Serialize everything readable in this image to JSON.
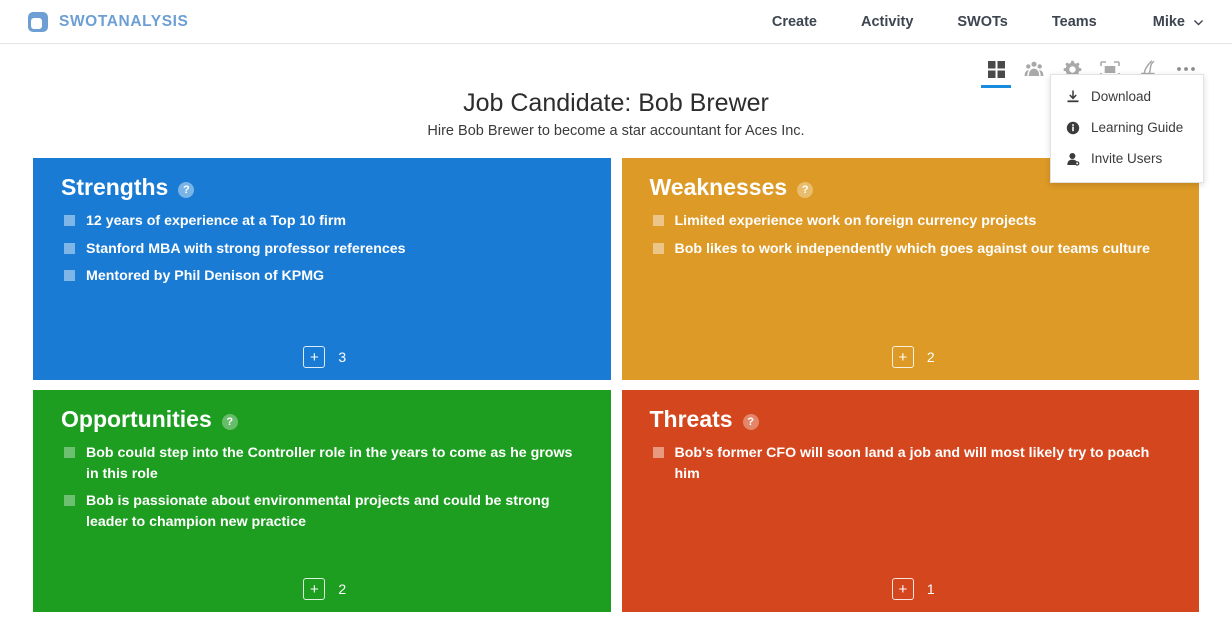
{
  "navbar": {
    "brand": "SWOTANALYSIS",
    "brand_icon": "swot-logo-icon",
    "links": [
      {
        "label": "Create"
      },
      {
        "label": "Activity"
      },
      {
        "label": "SWOTs"
      },
      {
        "label": "Teams"
      }
    ],
    "user": {
      "name": "Mike",
      "chevron_icon": "chevron-down-icon"
    }
  },
  "toolstrip": {
    "tools": [
      {
        "name": "grid-view-icon",
        "active": true
      },
      {
        "name": "team-people-icon",
        "active": false
      },
      {
        "name": "gear-settings-icon",
        "active": false
      },
      {
        "name": "presentation-icon",
        "active": false
      },
      {
        "name": "pen-signature-icon",
        "active": false
      },
      {
        "name": "more-options-icon",
        "active": false
      }
    ],
    "active_accent": "#1a8cdd"
  },
  "dropdown": {
    "visible": true,
    "items": [
      {
        "label": "Download",
        "icon": "download-icon"
      },
      {
        "label": "Learning Guide",
        "icon": "info-circle-icon"
      },
      {
        "label": "Invite Users",
        "icon": "user-add-icon"
      }
    ]
  },
  "header": {
    "title": "Job Candidate: Bob Brewer",
    "subtitle": "Hire Bob Brewer to become a star accountant for Aces Inc."
  },
  "swot": {
    "strengths": {
      "title": "Strengths",
      "color": "#1a7bd4",
      "help_icon": "question-mark-icon",
      "help_label": "?",
      "add_label": "+",
      "count": "3",
      "items": [
        "12 years of experience at a Top 10 firm",
        "Stanford MBA with strong professor references",
        "Mentored by Phil Denison of KPMG"
      ]
    },
    "weaknesses": {
      "title": "Weaknesses",
      "color": "#dd9a26",
      "help_icon": "question-mark-icon",
      "help_label": "?",
      "add_label": "+",
      "count": "2",
      "items": [
        "Limited experience work on foreign currency projects",
        "Bob likes to work independently which goes against our teams culture"
      ]
    },
    "opportunities": {
      "title": "Opportunities",
      "color": "#1d9e21",
      "help_icon": "question-mark-icon",
      "help_label": "?",
      "add_label": "+",
      "count": "2",
      "items": [
        "Bob could step into the Controller role in the years to come as he grows in this role",
        "Bob is passionate about environmental projects and could be strong leader to champion new practice"
      ]
    },
    "threats": {
      "title": "Threats",
      "color": "#d4461e",
      "help_icon": "question-mark-icon",
      "help_label": "?",
      "add_label": "+",
      "count": "1",
      "items": [
        "Bob's former CFO will soon land a job and will most likely try to poach him"
      ]
    }
  }
}
